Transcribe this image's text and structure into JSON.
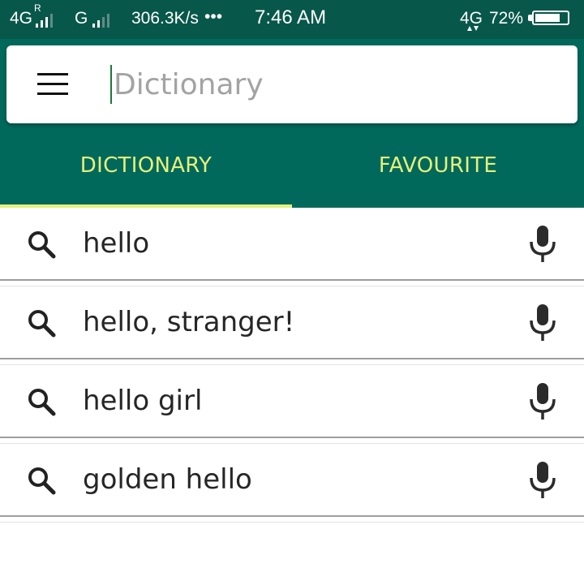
{
  "status_bar": {
    "network_left": "4G",
    "roaming": "R",
    "network_mid": "G",
    "speed": "306.3K/s",
    "more": "•••",
    "time": "7:46 AM",
    "network_right": "4G",
    "battery": "72%"
  },
  "search": {
    "placeholder": "Dictionary",
    "value": ""
  },
  "tabs": [
    {
      "label": "DICTIONARY",
      "selected": true
    },
    {
      "label": "FAVOURITE",
      "selected": false
    }
  ],
  "suggestions": [
    {
      "text": "hello"
    },
    {
      "text": "hello, stranger!"
    },
    {
      "text": "hello girl"
    },
    {
      "text": "golden hello"
    }
  ],
  "colors": {
    "status_bar": "#08574b",
    "app_bar": "#00695c",
    "tab_text": "#e7f07a",
    "tab_indicator": "#e4f07c"
  },
  "icons": {
    "menu": "hamburger-menu-icon",
    "row_left": "search-icon",
    "row_right": "microphone-icon"
  }
}
